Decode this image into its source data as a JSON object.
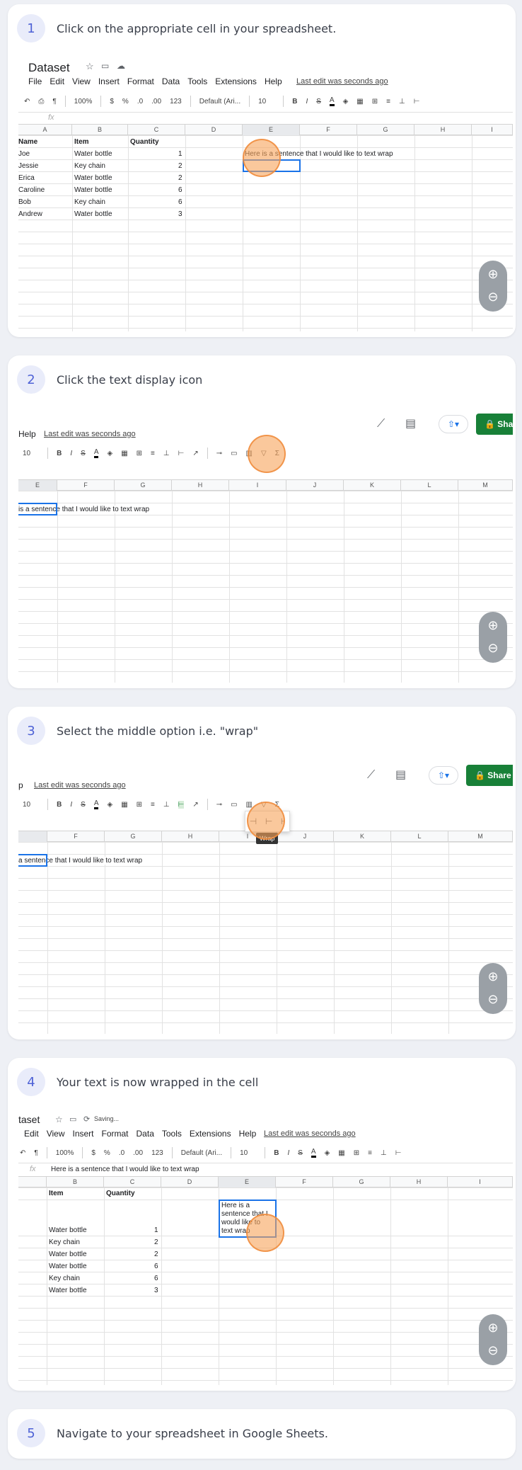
{
  "steps": [
    {
      "number": "1",
      "text": "Click on the appropriate cell in your spreadsheet."
    },
    {
      "number": "2",
      "text": "Click the text display icon"
    },
    {
      "number": "3",
      "text": "Select the middle option i.e. \"wrap\""
    },
    {
      "number": "4",
      "text": "Your text is now wrapped in the cell"
    },
    {
      "number": "5",
      "text": "Navigate to your spreadsheet in Google Sheets."
    }
  ],
  "sheet": {
    "doc_title": "Dataset",
    "doc_title_partial": "taset",
    "saving": "Saving...",
    "menu": [
      "File",
      "Edit",
      "View",
      "Insert",
      "Format",
      "Data",
      "Tools",
      "Extensions",
      "Help"
    ],
    "menu_partial": [
      "Edit",
      "View",
      "Insert",
      "Format",
      "Data",
      "Tools",
      "Extensions",
      "Help"
    ],
    "last_edit": "Last edit was seconds ago",
    "help": "Help",
    "help_partial": "p",
    "zoom": "100%",
    "currency": "$",
    "percent": "%",
    "dec_less": ".0",
    "dec_more": ".00",
    "num_format": "123",
    "font": "Default (Ari...",
    "font_size": "10",
    "bold": "B",
    "italic": "I",
    "strike": "S",
    "text_color": "A",
    "fx": "fx",
    "formula_value": "Here is a sentence that I would like to text wrap",
    "share": "Share",
    "wrap_tooltip": "Wrap",
    "headers": [
      "Name",
      "Item",
      "Quantity"
    ],
    "rows": [
      [
        "Joe",
        "Water bottle",
        "1"
      ],
      [
        "Jessie",
        "Key chain",
        "2"
      ],
      [
        "Erica",
        "Water bottle",
        "2"
      ],
      [
        "Caroline",
        "Water bottle",
        "6"
      ],
      [
        "Bob",
        "Key chain",
        "6"
      ],
      [
        "Andrew",
        "Water bottle",
        "3"
      ]
    ],
    "sentence": "Here is a sentence that I would like to text wrap",
    "sentence_from_is": "is a sentence that I would like to text wrap",
    "sentence_from_a": "a sentence that I would like to text wrap",
    "wrapped_lines": [
      "Here is a",
      "sentence that I",
      "would like to",
      "text wrap"
    ],
    "cols1": [
      "A",
      "B",
      "C",
      "D",
      "E",
      "F",
      "G",
      "H",
      "I"
    ],
    "cols2": [
      "E",
      "F",
      "G",
      "H",
      "I",
      "J",
      "K",
      "L",
      "M"
    ],
    "cols3": [
      "F",
      "G",
      "H",
      "I",
      "J",
      "K",
      "L",
      "M"
    ],
    "cols4": [
      "B",
      "C",
      "D",
      "E",
      "F",
      "G",
      "H",
      "I"
    ]
  },
  "colors": {
    "accent": "#4e62d6",
    "share_green": "#188038",
    "selection_blue": "#1a73e8",
    "highlight_orange": "#f7a45a"
  }
}
